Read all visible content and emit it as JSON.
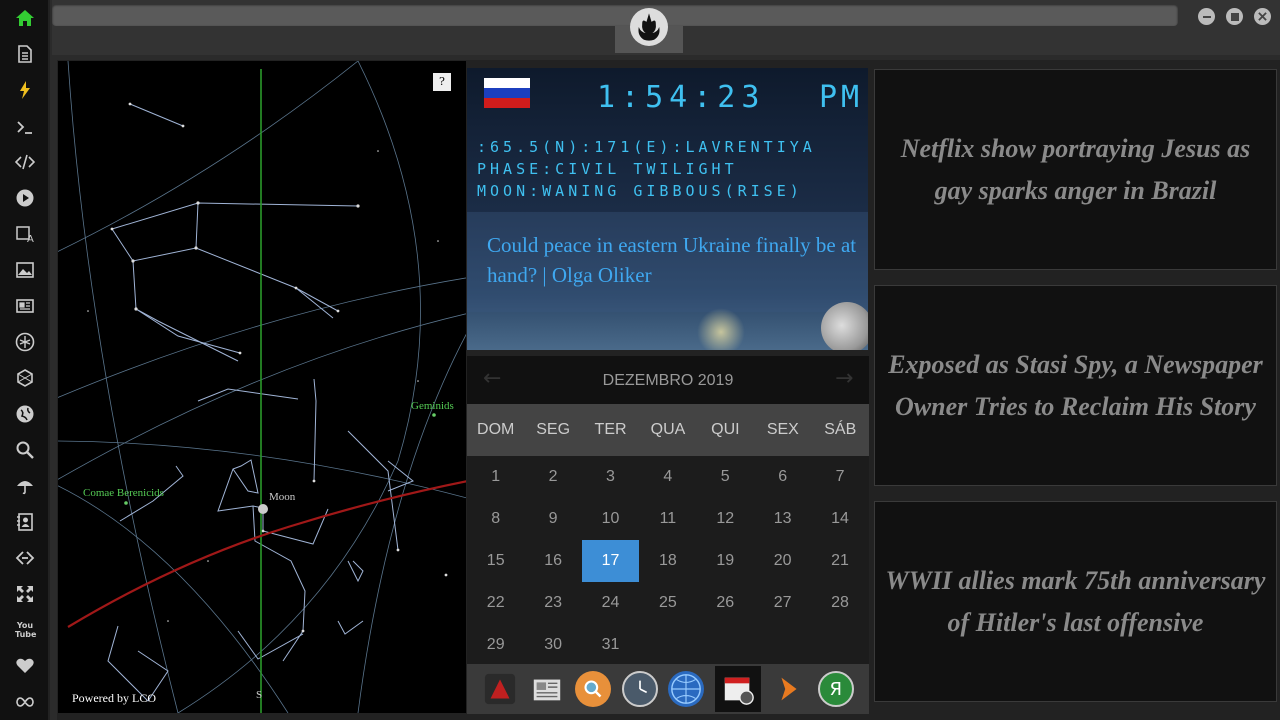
{
  "sidebar": {
    "icons": [
      "home-icon",
      "document-icon",
      "lightning-icon",
      "terminal-icon",
      "code-icon",
      "play-icon",
      "translate-icon",
      "image-icon",
      "newspaper-icon",
      "rebel-icon",
      "hexagon-icon",
      "globe-icon",
      "search-icon",
      "umbrella-icon",
      "contacts-icon",
      "link-icon",
      "expand-icon",
      "youtube-icon",
      "heart-icon",
      "infinity-icon"
    ],
    "youtube_label": "You Tube"
  },
  "window": {
    "emblem": "rebel-alliance-emblem"
  },
  "sky_map": {
    "help_label": "?",
    "labels": {
      "geminids": "Geminids",
      "comae": "Comae Berenicids",
      "moon": "Moon",
      "south": "S"
    },
    "powered_by": "Powered by LCO"
  },
  "clock": {
    "flag": "russia",
    "time": "1:54:23",
    "ampm": "PM",
    "location": ":65.5(N):171(E):LAVRENTIYA",
    "phase": "PHASE:CIVIL TWILIGHT",
    "moon": "MOON:WANING GIBBOUS(RISE)",
    "headline": "Could peace in eastern Ukraine finally be at hand? | Olga Oliker"
  },
  "calendar": {
    "title": "DEZEMBRO 2019",
    "weekdays": [
      "DOM",
      "SEG",
      "TER",
      "QUA",
      "QUI",
      "SEX",
      "SÁB"
    ],
    "weeks": [
      [
        "1",
        "2",
        "3",
        "4",
        "5",
        "6",
        "7"
      ],
      [
        "8",
        "9",
        "10",
        "11",
        "12",
        "13",
        "14"
      ],
      [
        "15",
        "16",
        "17",
        "18",
        "19",
        "20",
        "21"
      ],
      [
        "22",
        "23",
        "24",
        "25",
        "26",
        "27",
        "28"
      ],
      [
        "29",
        "30",
        "31",
        "",
        "",
        "",
        ""
      ]
    ],
    "selected": "17"
  },
  "dock": [
    "vpn-icon",
    "news-app-icon",
    "search-app-icon",
    "clock-app-icon",
    "globe-app-icon",
    "calendar-app-icon",
    "forward-app-icon",
    "yandex-icon"
  ],
  "news": [
    "Netflix show portraying Jesus as gay sparks anger in Brazil",
    "Exposed as Stasi Spy, a Newspaper Owner Tries to Reclaim His Story",
    "WWII allies mark 75th anniversary of Hitler's last offensive"
  ],
  "colors": {
    "accent": "#3d8ed6",
    "clock_text": "#3fc0f0",
    "headline": "#3fa8f0",
    "news_text": "#8a8a8a"
  }
}
